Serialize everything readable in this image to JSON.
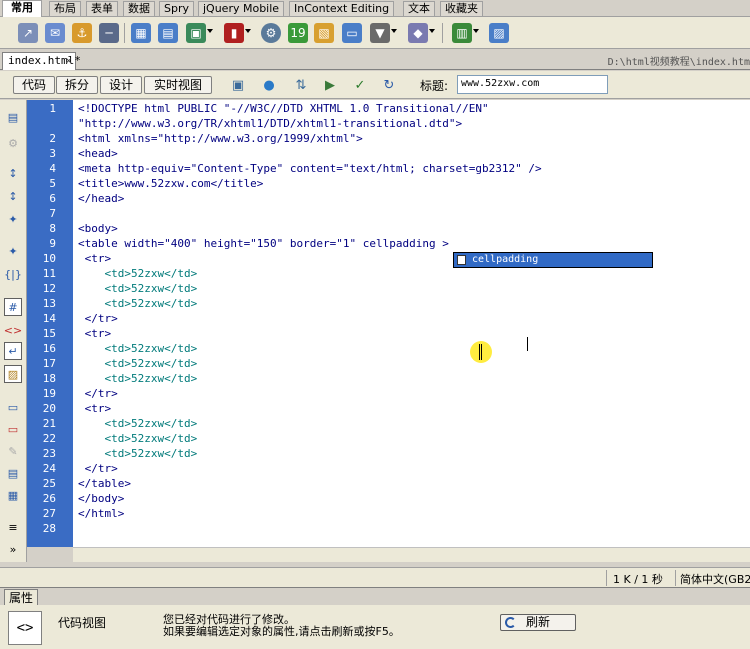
{
  "insert_bar": {
    "tabs": [
      "常用",
      "布局",
      "表单",
      "数据",
      "Spry",
      "jQuery Mobile",
      "InContext Editing",
      "文本",
      "收藏夹"
    ],
    "active_tab": "常用"
  },
  "document": {
    "tab_name": "index.html*",
    "close_glyph": "×",
    "path": "D:\\html视频教程\\index.htm"
  },
  "doc_toolbar": {
    "view_buttons": [
      "代码",
      "拆分",
      "设计",
      "实时视图"
    ],
    "title_label": "标题:",
    "title_value": "www.52zxw.com"
  },
  "code_lines": [
    "<!DOCTYPE html PUBLIC \"-//W3C//DTD XHTML 1.0 Transitional//EN\"",
    "\"http://www.w3.org/TR/xhtml1/DTD/xhtml1-transitional.dtd\">",
    "<html xmlns=\"http://www.w3.org/1999/xhtml\">",
    "<head>",
    "<meta http-equiv=\"Content-Type\" content=\"text/html; charset=gb2312\" />",
    "<title>www.52zxw.com</title>",
    "</head>",
    "",
    "<body>",
    "<table width=\"400\" height=\"150\" border=\"1\" cellpadding >",
    " <tr>",
    "    <td>52zxw</td>",
    "    <td>52zxw</td>",
    "    <td>52zxw</td>",
    " </tr>",
    " <tr>",
    "    <td>52zxw</td>",
    "    <td>52zxw</td>",
    "    <td>52zxw</td>",
    " </tr>",
    " <tr>",
    "    <td>52zxw</td>",
    "    <td>52zxw</td>",
    "    <td>52zxw</td>",
    " </tr>",
    "</table>",
    "</body>",
    "</html>",
    ""
  ],
  "line_numbers": [
    "1",
    "",
    "2",
    "3",
    "4",
    "5",
    "6",
    "7",
    "8",
    "9",
    "10",
    "11",
    "12",
    "13",
    "14",
    "15",
    "16",
    "17",
    "18",
    "19",
    "20",
    "21",
    "22",
    "23",
    "24",
    "25",
    "26",
    "27",
    "28"
  ],
  "code_hint": {
    "item": "cellpadding"
  },
  "status_bar": {
    "size_time": "1 K / 1 秒",
    "encoding": "简体中文(GB2312)"
  },
  "properties": {
    "tab": "属性",
    "icon_text": "<>",
    "view_label": "代码视图",
    "message_line1": "您已经对代码进行了修改。",
    "message_line2": "如果要编辑选定对象的属性,请点击刷新或按F5。",
    "refresh_label": "刷新"
  },
  "colors": {
    "gutter": "#3a6cc4",
    "code_text": "#000080",
    "hint_bg": "#316ac5",
    "cursor_highlight": "#ffe600"
  }
}
